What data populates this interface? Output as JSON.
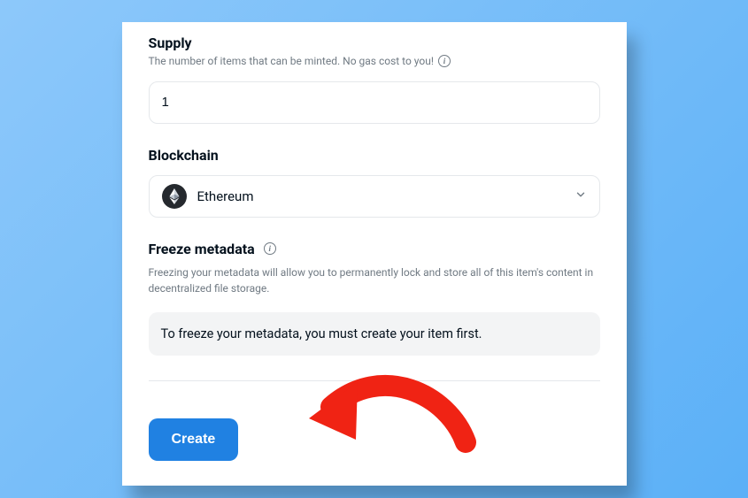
{
  "supply": {
    "label": "Supply",
    "help": "The number of items that can be minted. No gas cost to you!",
    "value": "1"
  },
  "blockchain": {
    "label": "Blockchain",
    "selected": "Ethereum"
  },
  "freeze": {
    "label": "Freeze metadata",
    "help": "Freezing your metadata will allow you to permanently lock and store all of this item's content in decentralized file storage.",
    "notice": "To freeze your metadata, you must create your item first."
  },
  "actions": {
    "create": "Create"
  }
}
